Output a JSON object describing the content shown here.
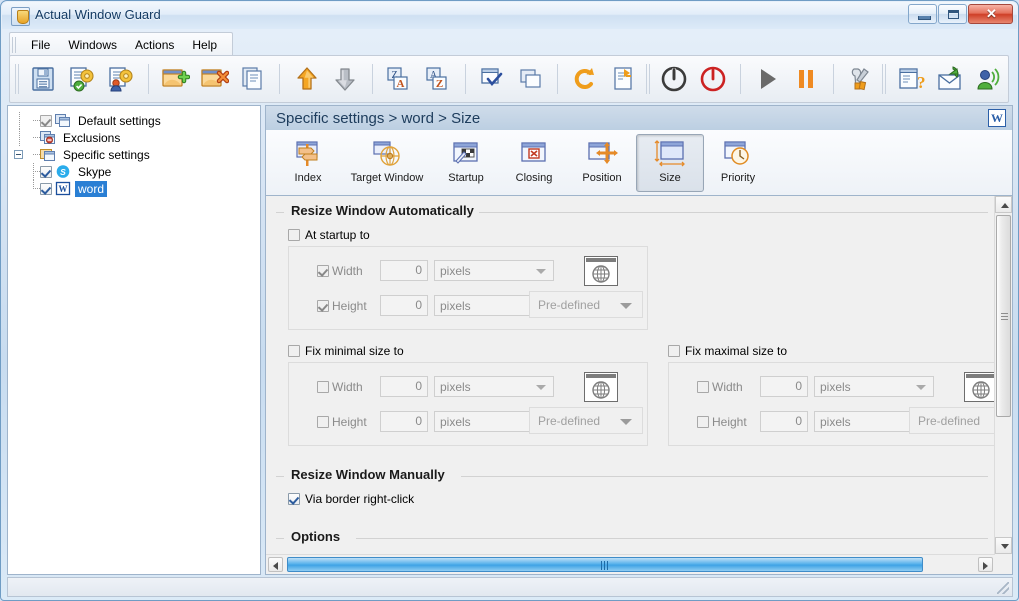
{
  "window": {
    "title": "Actual Window Guard",
    "app_icon": "shield-icon",
    "minimize_label": "─",
    "maximize_label": "□",
    "close_label": "✕"
  },
  "menu": {
    "items": [
      {
        "label": "File"
      },
      {
        "label": "Windows"
      },
      {
        "label": "Actions"
      },
      {
        "label": "Help"
      }
    ]
  },
  "toolbar": {
    "buttons": [
      {
        "name": "save-button",
        "icon": "floppy-disk-icon"
      },
      {
        "name": "apply-settings-button",
        "icon": "document-gear-green-icon"
      },
      {
        "name": "user-settings-button",
        "icon": "document-gear-user-icon"
      },
      {
        "name": "add-item-button",
        "icon": "window-add-icon"
      },
      {
        "name": "delete-item-button",
        "icon": "window-delete-icon"
      },
      {
        "name": "copy-item-button",
        "icon": "copy-pages-icon"
      },
      {
        "name": "move-up-button",
        "icon": "arrow-up-icon"
      },
      {
        "name": "move-down-button",
        "icon": "arrow-down-icon"
      },
      {
        "name": "sort-descending-button",
        "icon": "sort-za-icon"
      },
      {
        "name": "sort-ascending-button",
        "icon": "sort-az-icon"
      },
      {
        "name": "check-all-button",
        "icon": "window-check-icon"
      },
      {
        "name": "uncheck-all-button",
        "icon": "windows-stack-icon"
      },
      {
        "name": "undo-button",
        "icon": "undo-arrow-icon"
      },
      {
        "name": "export-button",
        "icon": "document-export-icon"
      },
      {
        "name": "enable-button",
        "icon": "power-icon"
      },
      {
        "name": "disable-button",
        "icon": "power-off-red-icon"
      },
      {
        "name": "start-button",
        "icon": "play-icon"
      },
      {
        "name": "pause-button",
        "icon": "pause-icon"
      },
      {
        "name": "configure-button",
        "icon": "wrench-screwdriver-icon"
      },
      {
        "name": "help-button",
        "icon": "help-document-icon"
      },
      {
        "name": "mail-button",
        "icon": "mail-envelope-icon"
      },
      {
        "name": "support-button",
        "icon": "support-person-icon"
      }
    ]
  },
  "tree": {
    "items": [
      {
        "label": "Default settings",
        "checkbox": "checked-gray",
        "icon": "windows-blue-icon",
        "selected": false,
        "expander": "none",
        "level": 1
      },
      {
        "label": "Exclusions",
        "checkbox": "none",
        "icon": "window-block-icon",
        "selected": false,
        "expander": "none",
        "level": 1
      },
      {
        "label": "Specific settings",
        "checkbox": "none",
        "icon": "folder-window-icon",
        "selected": false,
        "expander": "collapse",
        "level": 1
      },
      {
        "label": "Skype",
        "checkbox": "checked",
        "icon": "skype-icon",
        "selected": false,
        "expander": "none",
        "level": 2
      },
      {
        "label": "word",
        "checkbox": "checked",
        "icon": "word-icon",
        "selected": true,
        "expander": "none",
        "level": 2
      }
    ]
  },
  "breadcrumb": {
    "text": "Specific settings > word > Size",
    "app_badge": "W"
  },
  "tabs": [
    {
      "label": "Index",
      "icon": "signpost-icon",
      "active": false
    },
    {
      "label": "Target Window",
      "icon": "globe-target-icon",
      "active": false
    },
    {
      "label": "Startup",
      "icon": "window-flag-icon",
      "active": false
    },
    {
      "label": "Closing",
      "icon": "window-close-icon",
      "active": false
    },
    {
      "label": "Position",
      "icon": "window-move-icon",
      "active": false
    },
    {
      "label": "Size",
      "icon": "window-size-icon",
      "active": true
    },
    {
      "label": "Priority",
      "icon": "window-clock-icon",
      "active": false
    }
  ],
  "groups": {
    "auto": {
      "title": "Resize Window Automatically",
      "at_startup": {
        "label": "At startup to",
        "checked": false
      },
      "startup_fields": {
        "width": {
          "label": "Width",
          "checked": true,
          "value": "0",
          "unit": "pixels"
        },
        "height": {
          "label": "Height",
          "checked": true,
          "value": "0",
          "unit": "pixels"
        },
        "pick_button": "target-picker-icon",
        "predefined": "Pre-defined"
      },
      "fix_minimal": {
        "label": "Fix minimal size to",
        "checked": false
      },
      "minimal_fields": {
        "width": {
          "label": "Width",
          "checked": false,
          "value": "0",
          "unit": "pixels"
        },
        "height": {
          "label": "Height",
          "checked": false,
          "value": "0",
          "unit": "pixels"
        },
        "pick_button": "target-picker-icon",
        "predefined": "Pre-defined"
      },
      "fix_maximal": {
        "label": "Fix maximal size to",
        "checked": false
      },
      "maximal_fields": {
        "width": {
          "label": "Width",
          "checked": false,
          "value": "0",
          "unit": "pixels"
        },
        "height": {
          "label": "Height",
          "checked": false,
          "value": "0",
          "unit": "pixels"
        },
        "pick_button": "target-picker-icon",
        "predefined": "Pre-defined"
      }
    },
    "manual": {
      "title": "Resize Window Manually",
      "via_border": {
        "label": "Via border right-click",
        "checked": true
      }
    },
    "options": {
      "title": "Options"
    }
  },
  "scrollbars": {
    "vertical": {
      "up_arrow": "chevron-up-icon",
      "down_arrow": "chevron-down-icon"
    },
    "horizontal": {
      "left_arrow": "chevron-left-icon",
      "right_arrow": "chevron-right-icon"
    }
  },
  "colors": {
    "selection_blue": "#2a7fd4",
    "scroll_blue": "#3fa3e5",
    "title_text": "#133a63",
    "close_red": "#cf3f27",
    "disabled_gray": "#8a8a8a"
  }
}
